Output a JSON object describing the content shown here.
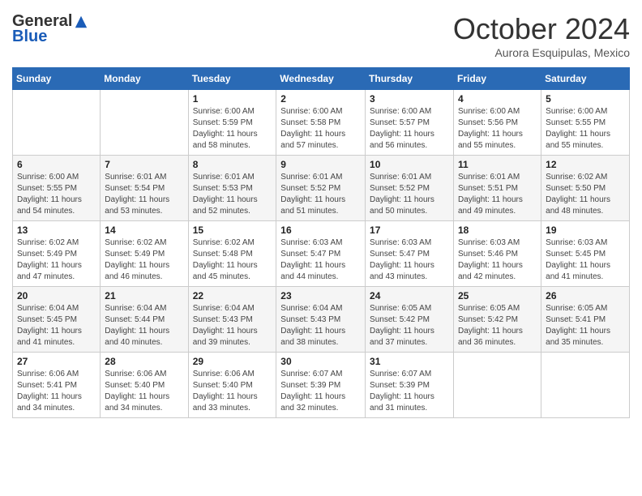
{
  "header": {
    "logo_general": "General",
    "logo_blue": "Blue",
    "month_title": "October 2024",
    "location": "Aurora Esquipulas, Mexico"
  },
  "days_of_week": [
    "Sunday",
    "Monday",
    "Tuesday",
    "Wednesday",
    "Thursday",
    "Friday",
    "Saturday"
  ],
  "weeks": [
    [
      {
        "day": "",
        "sunrise": "",
        "sunset": "",
        "daylight": ""
      },
      {
        "day": "",
        "sunrise": "",
        "sunset": "",
        "daylight": ""
      },
      {
        "day": "1",
        "sunrise": "Sunrise: 6:00 AM",
        "sunset": "Sunset: 5:59 PM",
        "daylight": "Daylight: 11 hours and 58 minutes."
      },
      {
        "day": "2",
        "sunrise": "Sunrise: 6:00 AM",
        "sunset": "Sunset: 5:58 PM",
        "daylight": "Daylight: 11 hours and 57 minutes."
      },
      {
        "day": "3",
        "sunrise": "Sunrise: 6:00 AM",
        "sunset": "Sunset: 5:57 PM",
        "daylight": "Daylight: 11 hours and 56 minutes."
      },
      {
        "day": "4",
        "sunrise": "Sunrise: 6:00 AM",
        "sunset": "Sunset: 5:56 PM",
        "daylight": "Daylight: 11 hours and 55 minutes."
      },
      {
        "day": "5",
        "sunrise": "Sunrise: 6:00 AM",
        "sunset": "Sunset: 5:55 PM",
        "daylight": "Daylight: 11 hours and 55 minutes."
      }
    ],
    [
      {
        "day": "6",
        "sunrise": "Sunrise: 6:00 AM",
        "sunset": "Sunset: 5:55 PM",
        "daylight": "Daylight: 11 hours and 54 minutes."
      },
      {
        "day": "7",
        "sunrise": "Sunrise: 6:01 AM",
        "sunset": "Sunset: 5:54 PM",
        "daylight": "Daylight: 11 hours and 53 minutes."
      },
      {
        "day": "8",
        "sunrise": "Sunrise: 6:01 AM",
        "sunset": "Sunset: 5:53 PM",
        "daylight": "Daylight: 11 hours and 52 minutes."
      },
      {
        "day": "9",
        "sunrise": "Sunrise: 6:01 AM",
        "sunset": "Sunset: 5:52 PM",
        "daylight": "Daylight: 11 hours and 51 minutes."
      },
      {
        "day": "10",
        "sunrise": "Sunrise: 6:01 AM",
        "sunset": "Sunset: 5:52 PM",
        "daylight": "Daylight: 11 hours and 50 minutes."
      },
      {
        "day": "11",
        "sunrise": "Sunrise: 6:01 AM",
        "sunset": "Sunset: 5:51 PM",
        "daylight": "Daylight: 11 hours and 49 minutes."
      },
      {
        "day": "12",
        "sunrise": "Sunrise: 6:02 AM",
        "sunset": "Sunset: 5:50 PM",
        "daylight": "Daylight: 11 hours and 48 minutes."
      }
    ],
    [
      {
        "day": "13",
        "sunrise": "Sunrise: 6:02 AM",
        "sunset": "Sunset: 5:49 PM",
        "daylight": "Daylight: 11 hours and 47 minutes."
      },
      {
        "day": "14",
        "sunrise": "Sunrise: 6:02 AM",
        "sunset": "Sunset: 5:49 PM",
        "daylight": "Daylight: 11 hours and 46 minutes."
      },
      {
        "day": "15",
        "sunrise": "Sunrise: 6:02 AM",
        "sunset": "Sunset: 5:48 PM",
        "daylight": "Daylight: 11 hours and 45 minutes."
      },
      {
        "day": "16",
        "sunrise": "Sunrise: 6:03 AM",
        "sunset": "Sunset: 5:47 PM",
        "daylight": "Daylight: 11 hours and 44 minutes."
      },
      {
        "day": "17",
        "sunrise": "Sunrise: 6:03 AM",
        "sunset": "Sunset: 5:47 PM",
        "daylight": "Daylight: 11 hours and 43 minutes."
      },
      {
        "day": "18",
        "sunrise": "Sunrise: 6:03 AM",
        "sunset": "Sunset: 5:46 PM",
        "daylight": "Daylight: 11 hours and 42 minutes."
      },
      {
        "day": "19",
        "sunrise": "Sunrise: 6:03 AM",
        "sunset": "Sunset: 5:45 PM",
        "daylight": "Daylight: 11 hours and 41 minutes."
      }
    ],
    [
      {
        "day": "20",
        "sunrise": "Sunrise: 6:04 AM",
        "sunset": "Sunset: 5:45 PM",
        "daylight": "Daylight: 11 hours and 41 minutes."
      },
      {
        "day": "21",
        "sunrise": "Sunrise: 6:04 AM",
        "sunset": "Sunset: 5:44 PM",
        "daylight": "Daylight: 11 hours and 40 minutes."
      },
      {
        "day": "22",
        "sunrise": "Sunrise: 6:04 AM",
        "sunset": "Sunset: 5:43 PM",
        "daylight": "Daylight: 11 hours and 39 minutes."
      },
      {
        "day": "23",
        "sunrise": "Sunrise: 6:04 AM",
        "sunset": "Sunset: 5:43 PM",
        "daylight": "Daylight: 11 hours and 38 minutes."
      },
      {
        "day": "24",
        "sunrise": "Sunrise: 6:05 AM",
        "sunset": "Sunset: 5:42 PM",
        "daylight": "Daylight: 11 hours and 37 minutes."
      },
      {
        "day": "25",
        "sunrise": "Sunrise: 6:05 AM",
        "sunset": "Sunset: 5:42 PM",
        "daylight": "Daylight: 11 hours and 36 minutes."
      },
      {
        "day": "26",
        "sunrise": "Sunrise: 6:05 AM",
        "sunset": "Sunset: 5:41 PM",
        "daylight": "Daylight: 11 hours and 35 minutes."
      }
    ],
    [
      {
        "day": "27",
        "sunrise": "Sunrise: 6:06 AM",
        "sunset": "Sunset: 5:41 PM",
        "daylight": "Daylight: 11 hours and 34 minutes."
      },
      {
        "day": "28",
        "sunrise": "Sunrise: 6:06 AM",
        "sunset": "Sunset: 5:40 PM",
        "daylight": "Daylight: 11 hours and 34 minutes."
      },
      {
        "day": "29",
        "sunrise": "Sunrise: 6:06 AM",
        "sunset": "Sunset: 5:40 PM",
        "daylight": "Daylight: 11 hours and 33 minutes."
      },
      {
        "day": "30",
        "sunrise": "Sunrise: 6:07 AM",
        "sunset": "Sunset: 5:39 PM",
        "daylight": "Daylight: 11 hours and 32 minutes."
      },
      {
        "day": "31",
        "sunrise": "Sunrise: 6:07 AM",
        "sunset": "Sunset: 5:39 PM",
        "daylight": "Daylight: 11 hours and 31 minutes."
      },
      {
        "day": "",
        "sunrise": "",
        "sunset": "",
        "daylight": ""
      },
      {
        "day": "",
        "sunrise": "",
        "sunset": "",
        "daylight": ""
      }
    ]
  ]
}
